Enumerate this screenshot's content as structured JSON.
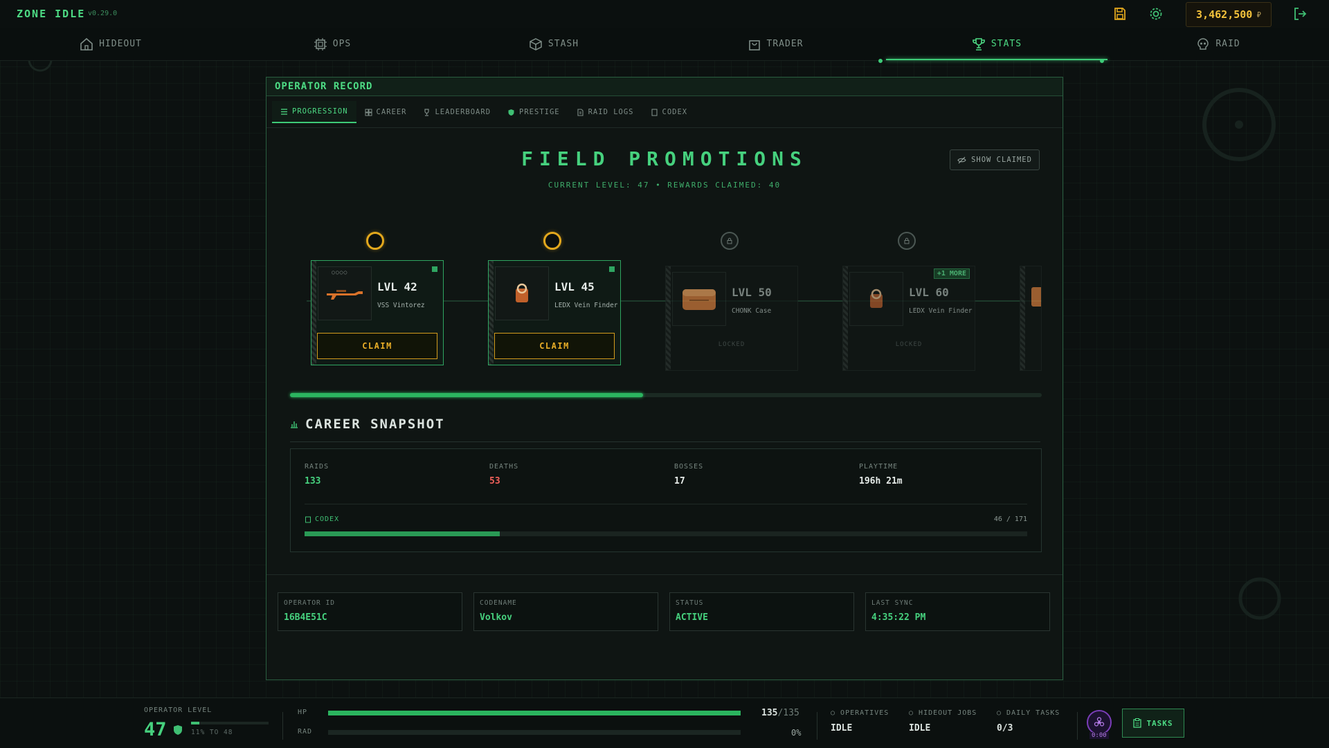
{
  "app": {
    "title": "ZONE IDLE",
    "version": "v0.29.0",
    "money": "3,462,500",
    "currency": "₽"
  },
  "nav": {
    "items": [
      {
        "label": "HIDEOUT",
        "icon": "home-icon"
      },
      {
        "label": "OPS",
        "icon": "chip-icon"
      },
      {
        "label": "STASH",
        "icon": "box-icon"
      },
      {
        "label": "TRADER",
        "icon": "bag-icon"
      },
      {
        "label": "STATS",
        "icon": "trophy-icon",
        "active": true
      },
      {
        "label": "RAID",
        "icon": "skull-icon"
      }
    ]
  },
  "panel": {
    "title": "OPERATOR RECORD",
    "tabs": [
      "PROGRESSION",
      "CAREER",
      "LEADERBOARD",
      "PRESTIGE",
      "RAID LOGS",
      "CODEX"
    ],
    "active_tab": "PROGRESSION",
    "promotions": {
      "title": "FIELD PROMOTIONS",
      "subtitle": "CURRENT LEVEL: 47 • REWARDS CLAIMED: 40",
      "show_claimed": "SHOW CLAIMED",
      "progress": 0.47,
      "rewards": [
        {
          "level": "LVL 42",
          "item": "VSS Vintorez",
          "state": "claimable",
          "action": "CLAIM"
        },
        {
          "level": "LVL 45",
          "item": "LEDX Vein Finder",
          "state": "claimable",
          "action": "CLAIM"
        },
        {
          "level": "LVL 50",
          "item": "CHONK Case",
          "state": "locked",
          "action": "LOCKED"
        },
        {
          "level": "LVL 60",
          "item": "LEDX Vein Finder",
          "state": "locked",
          "action": "LOCKED",
          "badge": "+1 MORE"
        }
      ]
    },
    "career": {
      "title": "CAREER SNAPSHOT",
      "stats": [
        {
          "label": "RAIDS",
          "value": "133",
          "color": "#46d17e"
        },
        {
          "label": "DEATHS",
          "value": "53",
          "color": "#f0605a"
        },
        {
          "label": "BOSSES",
          "value": "17",
          "color": "#e6ece9"
        },
        {
          "label": "PLAYTIME",
          "value": "196h 21m",
          "color": "#e6ece9"
        }
      ],
      "codex_label": "CODEX",
      "codex_count": "46 / 171",
      "codex_progress": 0.27
    },
    "operator": [
      {
        "label": "OPERATOR ID",
        "value": "16B4E51C"
      },
      {
        "label": "CODENAME",
        "value": "Volkov"
      },
      {
        "label": "STATUS",
        "value": "ACTIVE"
      },
      {
        "label": "LAST SYNC",
        "value": "4:35:22 PM"
      }
    ]
  },
  "bottom": {
    "operator_level_label": "OPERATOR LEVEL",
    "level": "47",
    "level_progress_text": "11% TO 48",
    "level_progress": 0.11,
    "hp_label": "HP",
    "hp_value": "135",
    "hp_max": "/135",
    "hp_progress": 1.0,
    "rad_label": "RAD",
    "rad_value": "0%",
    "operatives_label": "OPERATIVES",
    "operatives_value": "IDLE",
    "hideout_label": "HIDEOUT JOBS",
    "hideout_value": "IDLE",
    "daily_label": "DAILY TASKS",
    "daily_value": "0/3",
    "timer": "0:00",
    "tasks_label": "TASKS"
  },
  "colors": {
    "accent": "#46d17e",
    "gold": "#e3a81d",
    "danger": "#f0605a"
  }
}
